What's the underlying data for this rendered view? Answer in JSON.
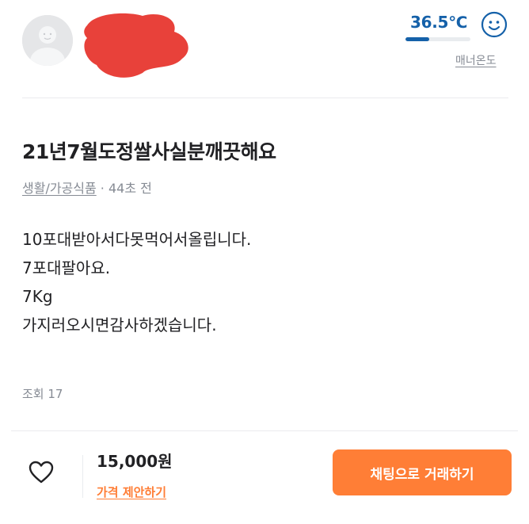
{
  "seller": {
    "manner_temperature": "36.5℃",
    "manner_temperature_level": 0.365,
    "manner_label": "매너온도"
  },
  "article": {
    "title": "21년7월도정쌀사실분깨끗해요",
    "category": "생활/가공식품",
    "meta_separator": " · ",
    "posted_time": "44초 전",
    "body_lines": [
      "10포대받아서다못먹어서올립니다.",
      "7포대팔아요.",
      "7Kg",
      "가지러오시면감사하겠습니다."
    ],
    "views": "조회 17"
  },
  "bottom_bar": {
    "price": "15,000원",
    "price_offer_label": "가격 제안하기",
    "chat_button_label": "채팅으로 거래하기"
  },
  "colors": {
    "accent": "#ff7e36",
    "temperature": "#1561a9",
    "redaction": "#e8413a"
  },
  "icons": {
    "avatar": "default-profile-icon",
    "temperature_face": "smiley-face-icon",
    "like": "heart-outline-icon"
  }
}
